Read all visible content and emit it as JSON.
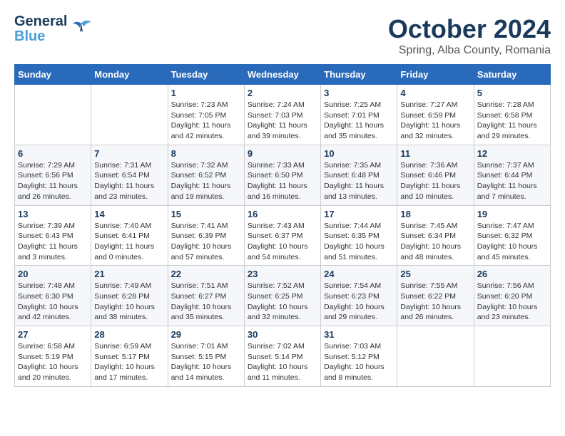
{
  "header": {
    "logo_line1": "General",
    "logo_line2": "Blue",
    "month_title": "October 2024",
    "location": "Spring, Alba County, Romania"
  },
  "weekdays": [
    "Sunday",
    "Monday",
    "Tuesday",
    "Wednesday",
    "Thursday",
    "Friday",
    "Saturday"
  ],
  "weeks": [
    [
      {
        "day": "",
        "info": ""
      },
      {
        "day": "",
        "info": ""
      },
      {
        "day": "1",
        "info": "Sunrise: 7:23 AM\nSunset: 7:05 PM\nDaylight: 11 hours and 42 minutes."
      },
      {
        "day": "2",
        "info": "Sunrise: 7:24 AM\nSunset: 7:03 PM\nDaylight: 11 hours and 39 minutes."
      },
      {
        "day": "3",
        "info": "Sunrise: 7:25 AM\nSunset: 7:01 PM\nDaylight: 11 hours and 35 minutes."
      },
      {
        "day": "4",
        "info": "Sunrise: 7:27 AM\nSunset: 6:59 PM\nDaylight: 11 hours and 32 minutes."
      },
      {
        "day": "5",
        "info": "Sunrise: 7:28 AM\nSunset: 6:58 PM\nDaylight: 11 hours and 29 minutes."
      }
    ],
    [
      {
        "day": "6",
        "info": "Sunrise: 7:29 AM\nSunset: 6:56 PM\nDaylight: 11 hours and 26 minutes."
      },
      {
        "day": "7",
        "info": "Sunrise: 7:31 AM\nSunset: 6:54 PM\nDaylight: 11 hours and 23 minutes."
      },
      {
        "day": "8",
        "info": "Sunrise: 7:32 AM\nSunset: 6:52 PM\nDaylight: 11 hours and 19 minutes."
      },
      {
        "day": "9",
        "info": "Sunrise: 7:33 AM\nSunset: 6:50 PM\nDaylight: 11 hours and 16 minutes."
      },
      {
        "day": "10",
        "info": "Sunrise: 7:35 AM\nSunset: 6:48 PM\nDaylight: 11 hours and 13 minutes."
      },
      {
        "day": "11",
        "info": "Sunrise: 7:36 AM\nSunset: 6:46 PM\nDaylight: 11 hours and 10 minutes."
      },
      {
        "day": "12",
        "info": "Sunrise: 7:37 AM\nSunset: 6:44 PM\nDaylight: 11 hours and 7 minutes."
      }
    ],
    [
      {
        "day": "13",
        "info": "Sunrise: 7:39 AM\nSunset: 6:43 PM\nDaylight: 11 hours and 3 minutes."
      },
      {
        "day": "14",
        "info": "Sunrise: 7:40 AM\nSunset: 6:41 PM\nDaylight: 11 hours and 0 minutes."
      },
      {
        "day": "15",
        "info": "Sunrise: 7:41 AM\nSunset: 6:39 PM\nDaylight: 10 hours and 57 minutes."
      },
      {
        "day": "16",
        "info": "Sunrise: 7:43 AM\nSunset: 6:37 PM\nDaylight: 10 hours and 54 minutes."
      },
      {
        "day": "17",
        "info": "Sunrise: 7:44 AM\nSunset: 6:35 PM\nDaylight: 10 hours and 51 minutes."
      },
      {
        "day": "18",
        "info": "Sunrise: 7:45 AM\nSunset: 6:34 PM\nDaylight: 10 hours and 48 minutes."
      },
      {
        "day": "19",
        "info": "Sunrise: 7:47 AM\nSunset: 6:32 PM\nDaylight: 10 hours and 45 minutes."
      }
    ],
    [
      {
        "day": "20",
        "info": "Sunrise: 7:48 AM\nSunset: 6:30 PM\nDaylight: 10 hours and 42 minutes."
      },
      {
        "day": "21",
        "info": "Sunrise: 7:49 AM\nSunset: 6:28 PM\nDaylight: 10 hours and 38 minutes."
      },
      {
        "day": "22",
        "info": "Sunrise: 7:51 AM\nSunset: 6:27 PM\nDaylight: 10 hours and 35 minutes."
      },
      {
        "day": "23",
        "info": "Sunrise: 7:52 AM\nSunset: 6:25 PM\nDaylight: 10 hours and 32 minutes."
      },
      {
        "day": "24",
        "info": "Sunrise: 7:54 AM\nSunset: 6:23 PM\nDaylight: 10 hours and 29 minutes."
      },
      {
        "day": "25",
        "info": "Sunrise: 7:55 AM\nSunset: 6:22 PM\nDaylight: 10 hours and 26 minutes."
      },
      {
        "day": "26",
        "info": "Sunrise: 7:56 AM\nSunset: 6:20 PM\nDaylight: 10 hours and 23 minutes."
      }
    ],
    [
      {
        "day": "27",
        "info": "Sunrise: 6:58 AM\nSunset: 5:19 PM\nDaylight: 10 hours and 20 minutes."
      },
      {
        "day": "28",
        "info": "Sunrise: 6:59 AM\nSunset: 5:17 PM\nDaylight: 10 hours and 17 minutes."
      },
      {
        "day": "29",
        "info": "Sunrise: 7:01 AM\nSunset: 5:15 PM\nDaylight: 10 hours and 14 minutes."
      },
      {
        "day": "30",
        "info": "Sunrise: 7:02 AM\nSunset: 5:14 PM\nDaylight: 10 hours and 11 minutes."
      },
      {
        "day": "31",
        "info": "Sunrise: 7:03 AM\nSunset: 5:12 PM\nDaylight: 10 hours and 8 minutes."
      },
      {
        "day": "",
        "info": ""
      },
      {
        "day": "",
        "info": ""
      }
    ]
  ]
}
